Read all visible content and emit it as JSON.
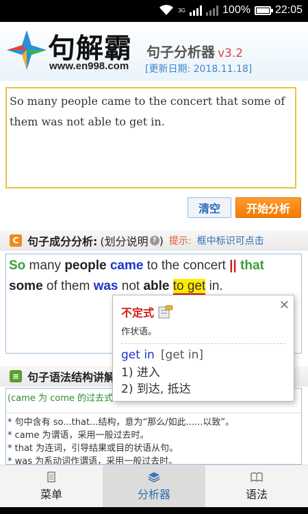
{
  "status_bar": {
    "network_type": "3G",
    "battery": "100%",
    "time": "22:05"
  },
  "header": {
    "logo_text": "句解霸",
    "logo_url": "www.en998.com",
    "app_title": "句子分析器",
    "version": "v3.2",
    "update_date": "[更新日期: 2018.11.18]"
  },
  "input": {
    "value": "So many people came to the concert that some of them was not able to get in."
  },
  "buttons": {
    "clear": "清空",
    "start": "开始分析"
  },
  "component_section": {
    "title": "句子成分分析:",
    "explain": "(划分说明",
    "explain_close": ")",
    "tip_label": "提示:",
    "tip_text": "框中标识可点击"
  },
  "analysis_tokens": {
    "t1": "So",
    "t2": " many ",
    "t3": "people",
    "t4": " ",
    "t5": "came",
    "t6": " to the concert ",
    "t7": "||",
    "t8": " ",
    "t9": "that",
    "t10": "some",
    "t11": " of them ",
    "t12": "was",
    "t13": " not ",
    "t14": "able",
    "t15": " ",
    "t16": "to get",
    "t17": " in."
  },
  "grammar_section": {
    "title": "句子语法结构讲解",
    "note": "(came 为 come 的过去式",
    "rules": [
      "* 句中含有 so...that...结构，意为“那么/如此......以致”。",
      "* came 为谓语，采用一般过去时。",
      "* that 为连词，引导结果或目的状语从句。",
      "* was 为系动词作谓语，采用一般过去时。"
    ]
  },
  "popup": {
    "close": "✕",
    "title": "不定式",
    "subtitle": "作状语。",
    "word": "get in",
    "phonetic": "[get in]",
    "def1": "1) 进入",
    "def2": "2) 到达, 抵达"
  },
  "nav": {
    "items": [
      {
        "label": "菜单",
        "icon": "menu-icon"
      },
      {
        "label": "分析器",
        "icon": "layers-icon"
      },
      {
        "label": "语法",
        "icon": "book-icon"
      }
    ],
    "active": "分析器"
  },
  "colors": {
    "accent_orange": "#f27b00",
    "link_blue": "#2d6cb1",
    "highlight_yellow": "#ffea00",
    "input_border": "#e8c43a"
  }
}
